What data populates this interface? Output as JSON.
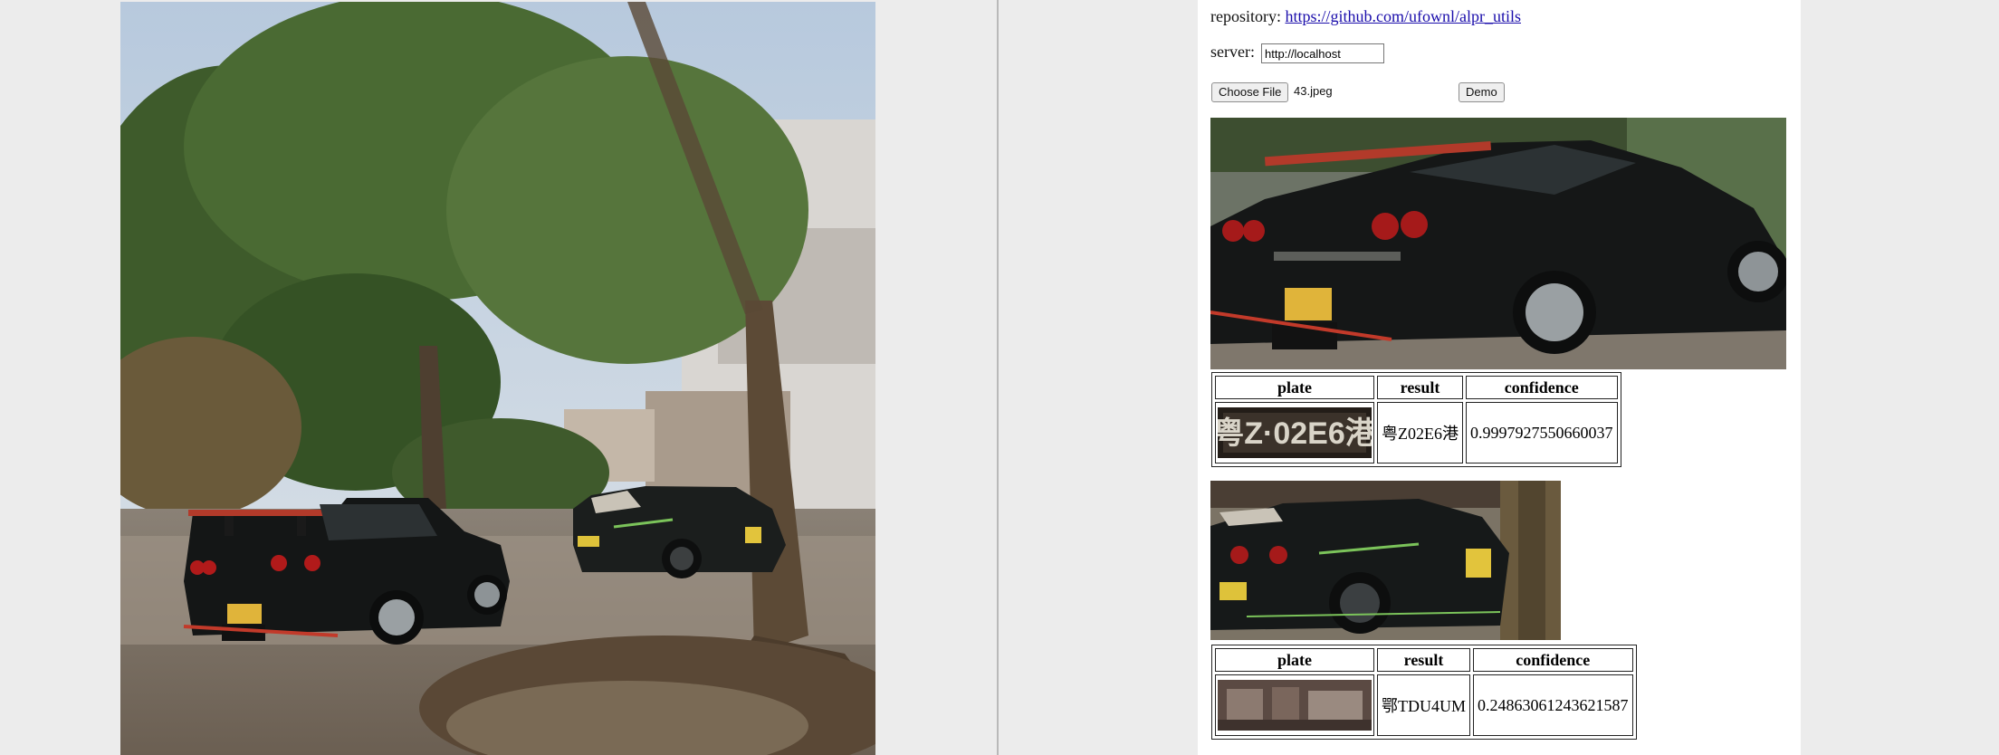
{
  "repository": {
    "label": "repository:",
    "link_text": "https://github.com/ufownl/alpr_utils"
  },
  "server": {
    "label": "server:",
    "value": "http://localhost"
  },
  "file": {
    "choose_label": "Choose File",
    "file_name": "43.jpeg",
    "demo_label": "Demo"
  },
  "results": [
    {
      "headers": {
        "plate": "plate",
        "result": "result",
        "confidence": "confidence"
      },
      "result": "粤Z02E6港",
      "confidence": "0.9997927550660037",
      "plate_image_text": "粤Z·02E6港"
    },
    {
      "headers": {
        "plate": "plate",
        "result": "result",
        "confidence": "confidence"
      },
      "result": "鄂TDU4UM",
      "confidence": "0.24863061243621587"
    }
  ],
  "colors": {
    "link": "#1a0dab",
    "car_body": "#17191a",
    "plate_yellow": "#e0b43a",
    "foliage": "#3d5a2a"
  }
}
